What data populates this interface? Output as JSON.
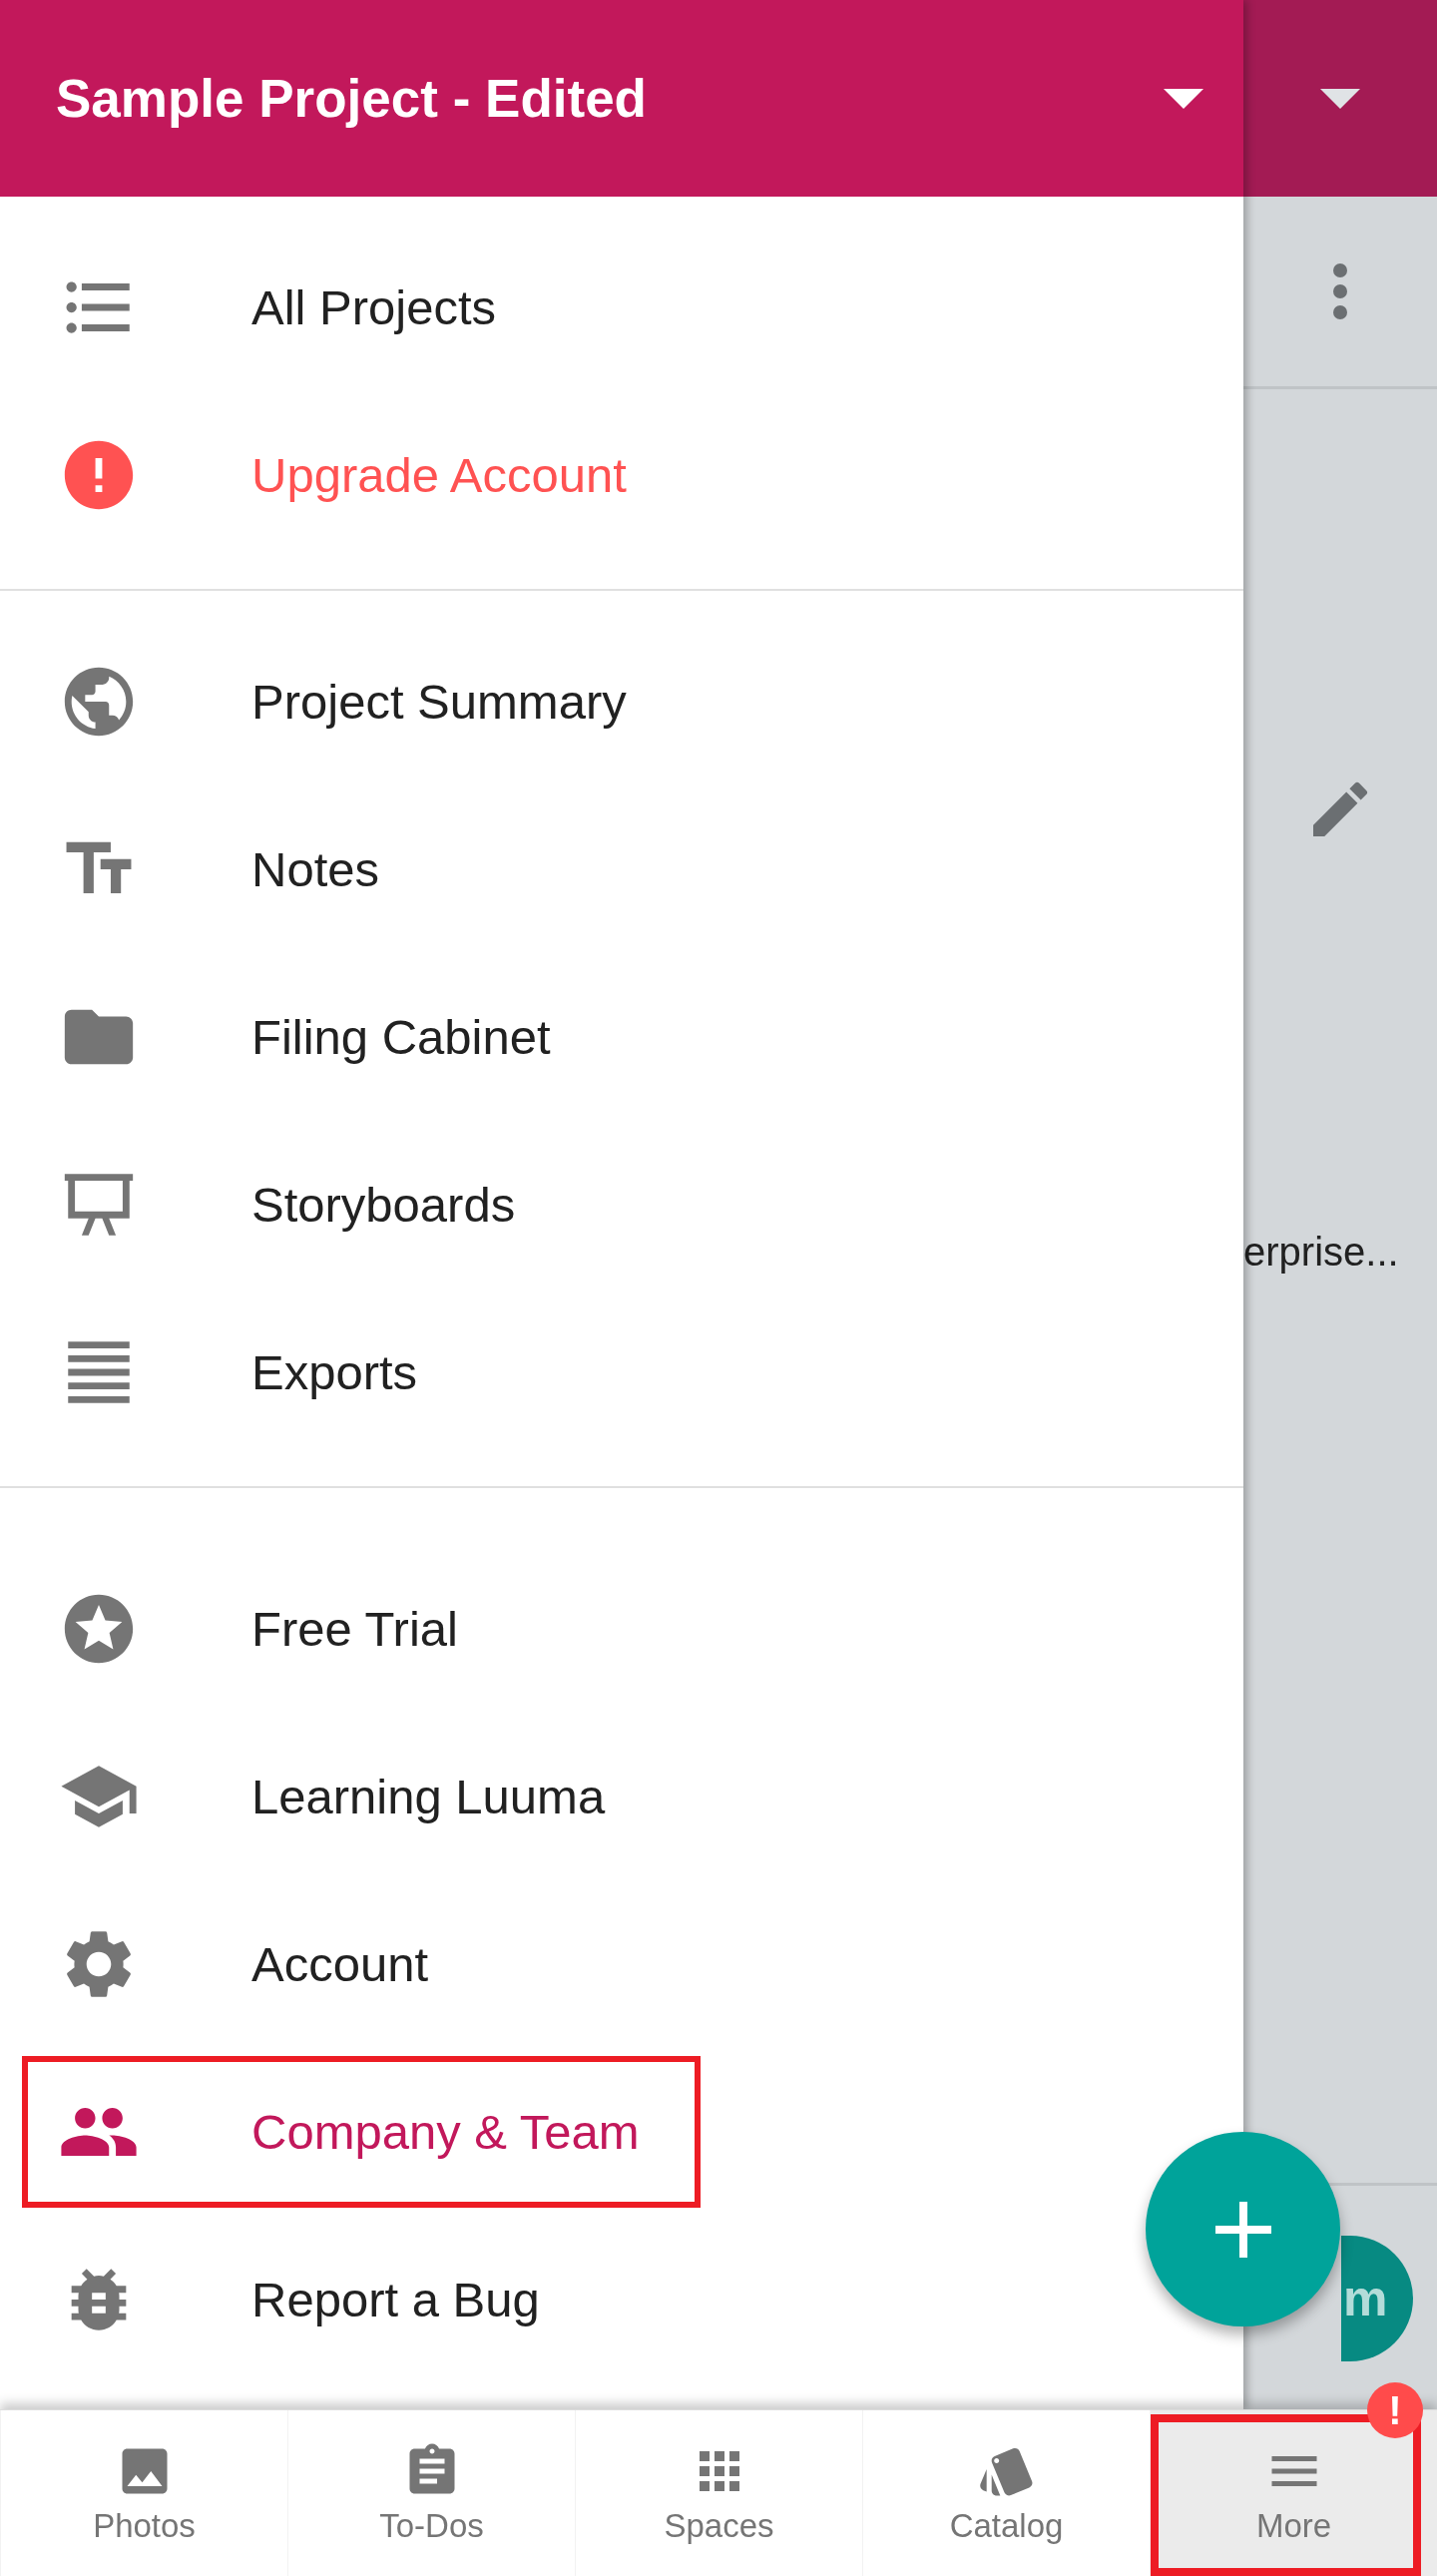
{
  "drawer": {
    "title": "Sample Project - Edited",
    "sections": [
      {
        "items": [
          {
            "label": "All Projects",
            "kind": "normal",
            "highlighted": false
          },
          {
            "label": "Upgrade Account",
            "kind": "warning",
            "highlighted": false
          }
        ]
      },
      {
        "items": [
          {
            "label": "Project Summary",
            "kind": "normal",
            "highlighted": false
          },
          {
            "label": "Notes",
            "kind": "normal",
            "highlighted": false
          },
          {
            "label": "Filing Cabinet",
            "kind": "normal",
            "highlighted": false
          },
          {
            "label": "Storyboards",
            "kind": "normal",
            "highlighted": false
          },
          {
            "label": "Exports",
            "kind": "normal",
            "highlighted": false
          }
        ]
      },
      {
        "items": [
          {
            "label": "Free Trial",
            "kind": "normal",
            "highlighted": false
          },
          {
            "label": "Learning Luuma",
            "kind": "normal",
            "highlighted": false
          },
          {
            "label": "Account",
            "kind": "normal",
            "highlighted": false
          },
          {
            "label": "Company & Team",
            "kind": "current",
            "highlighted": true
          },
          {
            "label": "Report a Bug",
            "kind": "normal",
            "highlighted": false
          }
        ]
      }
    ]
  },
  "background": {
    "text": "erprise...",
    "button_label": "m"
  },
  "bottom_nav": [
    {
      "label": "Photos",
      "selected": false,
      "highlighted": false
    },
    {
      "label": "To-Dos",
      "selected": false,
      "highlighted": false
    },
    {
      "label": "Spaces",
      "selected": false,
      "highlighted": false
    },
    {
      "label": "Catalog",
      "selected": false,
      "highlighted": false
    },
    {
      "label": "More",
      "selected": true,
      "highlighted": true,
      "badge": "!"
    }
  ]
}
